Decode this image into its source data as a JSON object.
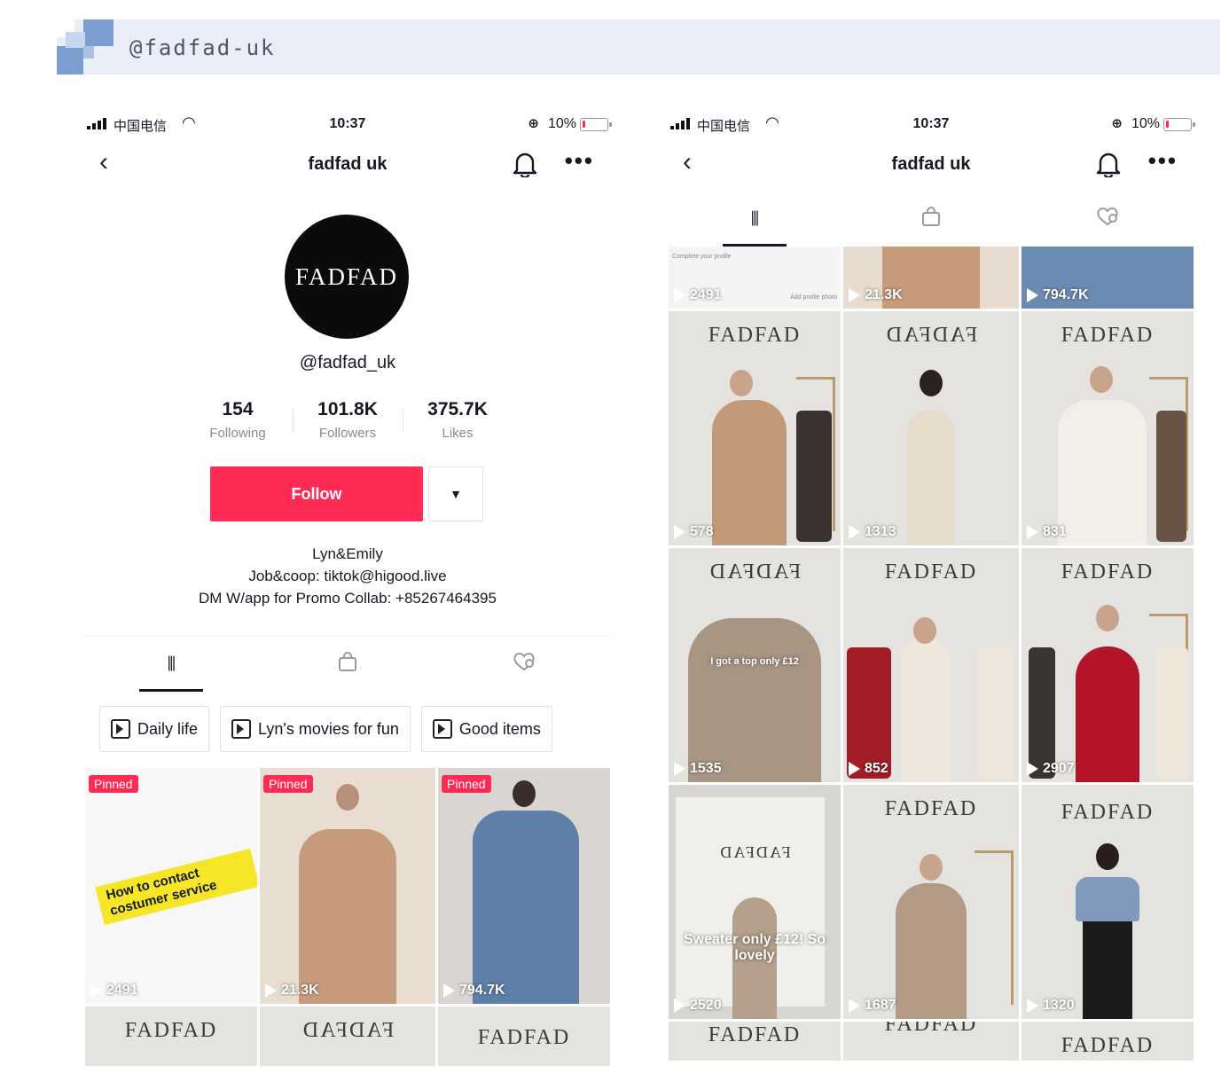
{
  "banner": {
    "handle": "@fadfad-uk"
  },
  "status": {
    "carrier": "中国电信",
    "time": "10:37",
    "battery": "10%"
  },
  "profile": {
    "title": "fadfad uk",
    "avatar_text": "FADFAD",
    "handle": "@fadfad_uk",
    "stats": [
      {
        "value": "154",
        "label": "Following"
      },
      {
        "value": "101.8K",
        "label": "Followers"
      },
      {
        "value": "375.7K",
        "label": "Likes"
      }
    ],
    "follow_label": "Follow",
    "bio": [
      "Lyn&Emily",
      "Job&coop: tiktok@higood.live",
      "DM W/app for Promo Collab: +85267464395"
    ],
    "playlists": [
      "Daily life",
      "Lyn's movies for fun",
      "Good items"
    ],
    "pinned_label": "Pinned",
    "sticker_text": "How to contact costumer service",
    "grid": [
      {
        "views": "2491",
        "pinned": true
      },
      {
        "views": "21.3K",
        "pinned": true
      },
      {
        "views": "794.7K",
        "pinned": true
      },
      {
        "brand": "FADFAD"
      },
      {
        "brand": "FADFAD"
      },
      {
        "brand": "FADFAD"
      }
    ]
  },
  "right": {
    "title": "fadfad uk",
    "brand": "FADFAD",
    "top_row": [
      "2491",
      "21.3K",
      "794.7K"
    ],
    "top_row_text": {
      "complete_profile": "Complete your profile",
      "add_photo": "Add profile photo"
    },
    "captions": {
      "top_sale": "I got a top only £12",
      "sweater": "Sweater only £12! So lovely"
    },
    "grid": [
      {
        "views": "578"
      },
      {
        "views": "1313"
      },
      {
        "views": "831"
      },
      {
        "views": "1535"
      },
      {
        "views": "852"
      },
      {
        "views": "2907"
      },
      {
        "views": "2520"
      },
      {
        "views": "1687"
      },
      {
        "views": "1320"
      }
    ]
  },
  "colors": {
    "accent": "#fe2c55",
    "banner_bg": "#e9eef8",
    "text": "#161823"
  },
  "icons": [
    "back-icon",
    "bell-icon",
    "more-icon",
    "grid-icon",
    "bag-icon",
    "liked-heart-icon",
    "playlist-icon",
    "play-icon",
    "signal-icon",
    "wifi-icon",
    "battery-icon"
  ]
}
